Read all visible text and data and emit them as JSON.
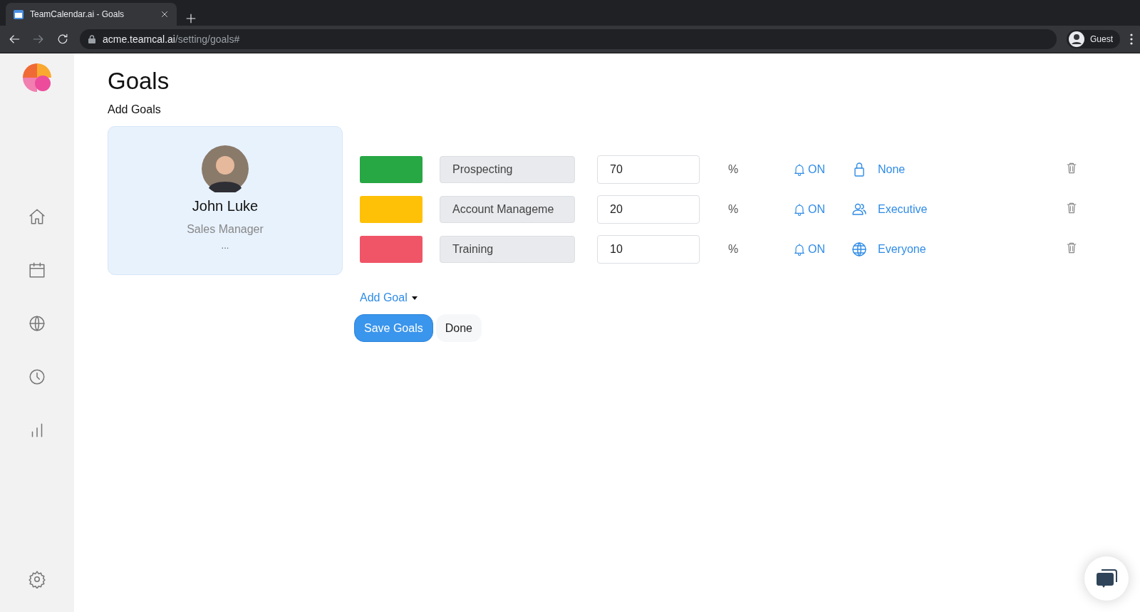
{
  "browser": {
    "tab_title": "TeamCalendar.ai - Goals",
    "url_host": "acme.teamcal.ai",
    "url_path": "/setting/goals#",
    "profile": "Guest"
  },
  "page": {
    "title": "Goals",
    "subtitle": "Add Goals"
  },
  "profile_card": {
    "name": "John Luke",
    "role": "Sales Manager",
    "more": "..."
  },
  "goals": [
    {
      "color": "#28a745",
      "name": "Prospecting",
      "percent": "70",
      "unit": "%",
      "alert": "ON",
      "visibility": {
        "kind": "lock",
        "label": "None"
      }
    },
    {
      "color": "#ffc107",
      "name": "Account Manageme",
      "percent": "20",
      "unit": "%",
      "alert": "ON",
      "visibility": {
        "kind": "group",
        "label": "Executive"
      }
    },
    {
      "color": "#ef5567",
      "name": "Training",
      "percent": "10",
      "unit": "%",
      "alert": "ON",
      "visibility": {
        "kind": "globe",
        "label": "Everyone"
      }
    }
  ],
  "add_goal": "Add Goal",
  "buttons": {
    "save": "Save Goals",
    "done": "Done"
  }
}
